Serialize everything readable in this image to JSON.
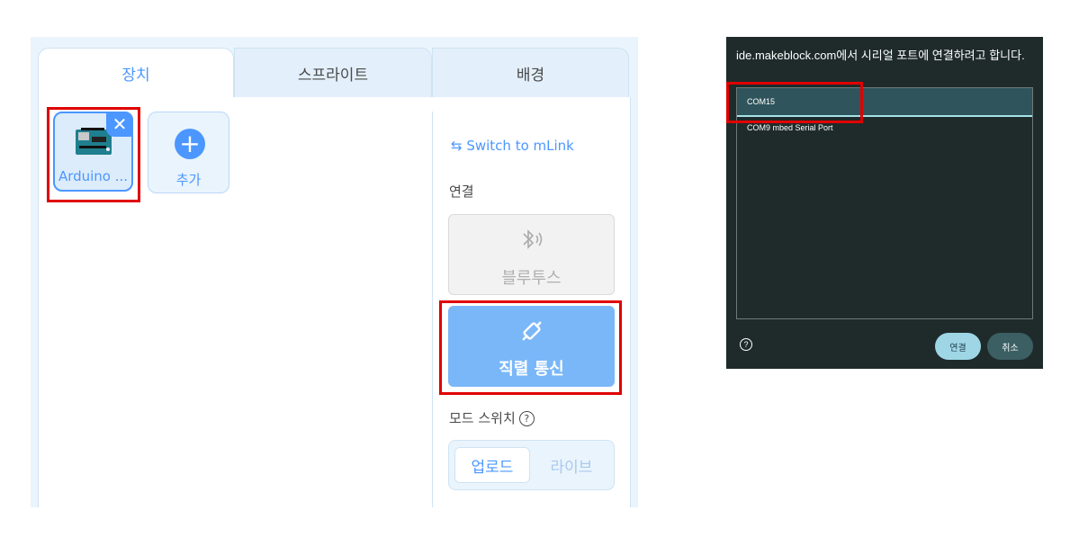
{
  "tabs": {
    "device": "장치",
    "sprite": "스프라이트",
    "background": "배경"
  },
  "device_card": {
    "label": "Arduino ...",
    "close_glyph": "✕",
    "image_icon": "arduino-board-icon"
  },
  "add_card": {
    "icon": "+",
    "label": "추가"
  },
  "connection": {
    "switch_link": "⇆ Switch to mLink",
    "section_label": "연결",
    "bluetooth_label": "블루투스",
    "serial_label": "직렬 통신",
    "mode_label": "모드 스위치",
    "help_glyph": "?",
    "mode_upload": "업로드",
    "mode_live": "라이브"
  },
  "dialog": {
    "title": "ide.makeblock.com에서 시리얼 포트에 연결하려고 합니다.",
    "ports": [
      "COM15",
      "COM9 mbed Serial Port"
    ],
    "help_glyph": "?",
    "connect": "연결",
    "cancel": "취소"
  },
  "colors": {
    "accent": "#4c97ff",
    "highlight": "#e00000",
    "dialog_bg": "#1f2b2b"
  }
}
